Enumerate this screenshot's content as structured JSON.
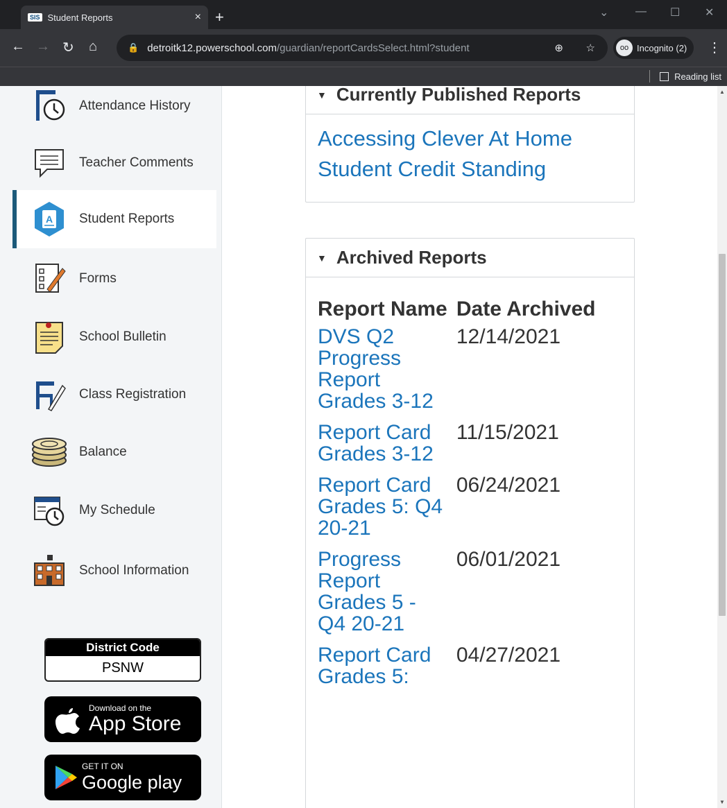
{
  "browser": {
    "tab_favicon": "SIS",
    "tab_title": "Student Reports",
    "tab_close": "×",
    "new_tab": "+",
    "url_host": "detroitk12.powerschool.com",
    "url_path": "/guardian/reportCardsSelect.html?student",
    "incognito_label": "Incognito (2)",
    "reading_list": "Reading list"
  },
  "sidebar": {
    "items": [
      {
        "label": "Attendance History",
        "icon": "attendance-icon"
      },
      {
        "label": "Teacher Comments",
        "icon": "comments-icon"
      },
      {
        "label": "Student Reports",
        "icon": "reports-icon"
      },
      {
        "label": "Forms",
        "icon": "forms-icon"
      },
      {
        "label": "School Bulletin",
        "icon": "bulletin-icon"
      },
      {
        "label": "Class Registration",
        "icon": "registration-icon"
      },
      {
        "label": "Balance",
        "icon": "balance-icon"
      },
      {
        "label": "My Schedule",
        "icon": "schedule-icon"
      },
      {
        "label": "School Information",
        "icon": "school-icon"
      }
    ],
    "district_code_label": "District Code",
    "district_code_value": "PSNW",
    "app_store_small": "Download on the",
    "app_store_big": "App Store",
    "google_small": "GET IT ON",
    "google_big": "Google play"
  },
  "published": {
    "title": "Currently Published Reports",
    "links": [
      "Accessing Clever At Home",
      "Student Credit Standing"
    ]
  },
  "archived": {
    "title": "Archived Reports",
    "col_name": "Report Name",
    "col_date": "Date Archived",
    "rows": [
      {
        "name": "DVS Q2 Progress Report Grades 3-12",
        "date": "12/14/2021"
      },
      {
        "name": "Report Card Grades 3-12",
        "date": "11/15/2021"
      },
      {
        "name": "Report Card Grades 5: Q4 20-21",
        "date": "06/24/2021"
      },
      {
        "name": "Progress Report Grades 5 - Q4 20-21",
        "date": "06/01/2021"
      },
      {
        "name": "Report Card Grades 5:",
        "date": "04/27/2021"
      }
    ]
  },
  "colors": {
    "link": "#1b75bb",
    "active_bar": "#1c5a7a",
    "sidebar_bg": "#f3f5f7"
  }
}
